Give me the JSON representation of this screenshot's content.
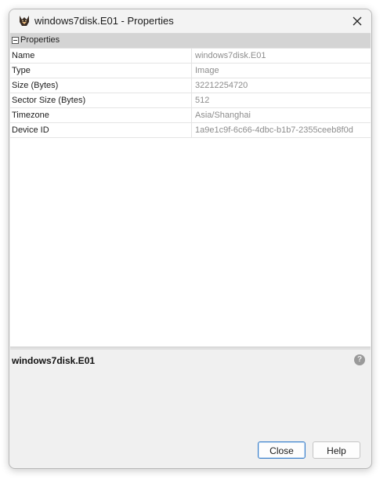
{
  "window": {
    "title": "windows7disk.E01 - Properties"
  },
  "section": {
    "label": "Properties"
  },
  "properties": [
    {
      "key": "Name",
      "value": "windows7disk.E01"
    },
    {
      "key": "Type",
      "value": "Image"
    },
    {
      "key": "Size (Bytes)",
      "value": "32212254720"
    },
    {
      "key": "Sector Size (Bytes)",
      "value": "512"
    },
    {
      "key": "Timezone",
      "value": "Asia/Shanghai"
    },
    {
      "key": "Device ID",
      "value": "1a9e1c9f-6c66-4dbc-b1b7-2355ceeb8f0d"
    }
  ],
  "description": {
    "title": "windows7disk.E01",
    "help_icon": "?"
  },
  "buttons": {
    "close_label": "Close",
    "help_label": "Help"
  },
  "icons": {
    "app": "autopsy-dog-icon",
    "close": "close-icon",
    "collapse": "collapse-minus-icon",
    "help": "help-icon"
  }
}
